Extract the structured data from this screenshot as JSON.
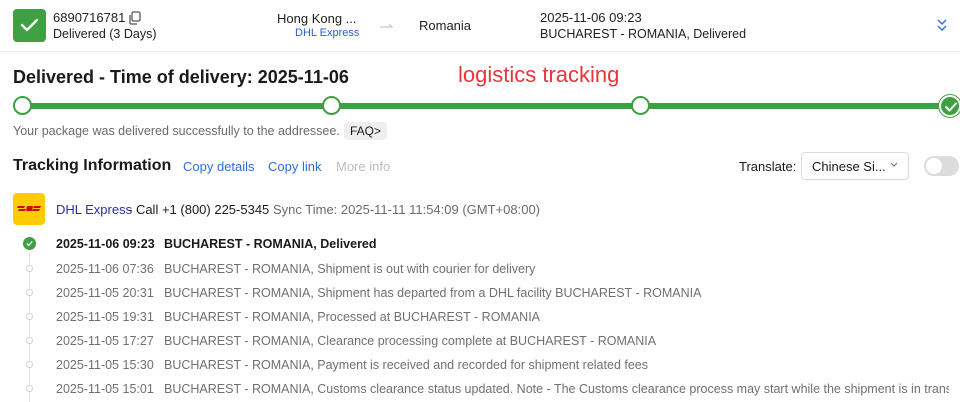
{
  "header": {
    "tracking_number": "6890716781",
    "status": "Delivered (3 Days)",
    "origin": "Hong Kong ...",
    "carrier": "DHL Express",
    "destination": "Romania",
    "latest_time": "2025-11-06 09:23",
    "latest_event": "BUCHAREST - ROMANIA, Delivered"
  },
  "delivery": {
    "title": "Delivered - Time of delivery: 2025-11-06",
    "annotation": "logistics tracking",
    "progress": 1.0,
    "message": "Your package was delivered successfully to the addressee.",
    "faq_label": "FAQ>"
  },
  "tracking_info": {
    "title": "Tracking Information",
    "copy_details": "Copy details",
    "copy_link": "Copy link",
    "more_info": "More info",
    "translate_label": "Translate:",
    "translate_value": "Chinese Si..."
  },
  "carrier_row": {
    "name": "DHL Express",
    "phone": "- Call +1 (800) 225-5345",
    "sync": "Sync Time: 2025-11-11 11:54:09 (GMT+08:00)"
  },
  "events": [
    {
      "time": "2025-11-06 09:23",
      "desc": "BUCHAREST - ROMANIA, Delivered"
    },
    {
      "time": "2025-11-06 07:36",
      "desc": "BUCHAREST - ROMANIA, Shipment is out with courier for delivery"
    },
    {
      "time": "2025-11-05 20:31",
      "desc": "BUCHAREST - ROMANIA, Shipment has departed from a DHL facility BUCHAREST - ROMANIA"
    },
    {
      "time": "2025-11-05 19:31",
      "desc": "BUCHAREST - ROMANIA, Processed at BUCHAREST - ROMANIA"
    },
    {
      "time": "2025-11-05 17:27",
      "desc": "BUCHAREST - ROMANIA, Clearance processing complete at BUCHAREST - ROMANIA"
    },
    {
      "time": "2025-11-05 15:30",
      "desc": "BUCHAREST - ROMANIA, Payment is received and recorded for shipment related fees"
    },
    {
      "time": "2025-11-05 15:01",
      "desc": "BUCHAREST - ROMANIA, Customs clearance status updated. Note - The Customs clearance process may start while the shipment is in transit"
    }
  ],
  "colors": {
    "success": "#3ea043",
    "link": "#2d6fe0",
    "carrier_link": "#2d2da8",
    "annotation": "#e8353b",
    "dhl_yellow": "#ffcc00",
    "dhl_red": "#d40511"
  },
  "icons": [
    "check-icon",
    "copy-icon",
    "route-arrow-icon",
    "expand-icon",
    "chevron-down-icon",
    "dhl-logo"
  ]
}
